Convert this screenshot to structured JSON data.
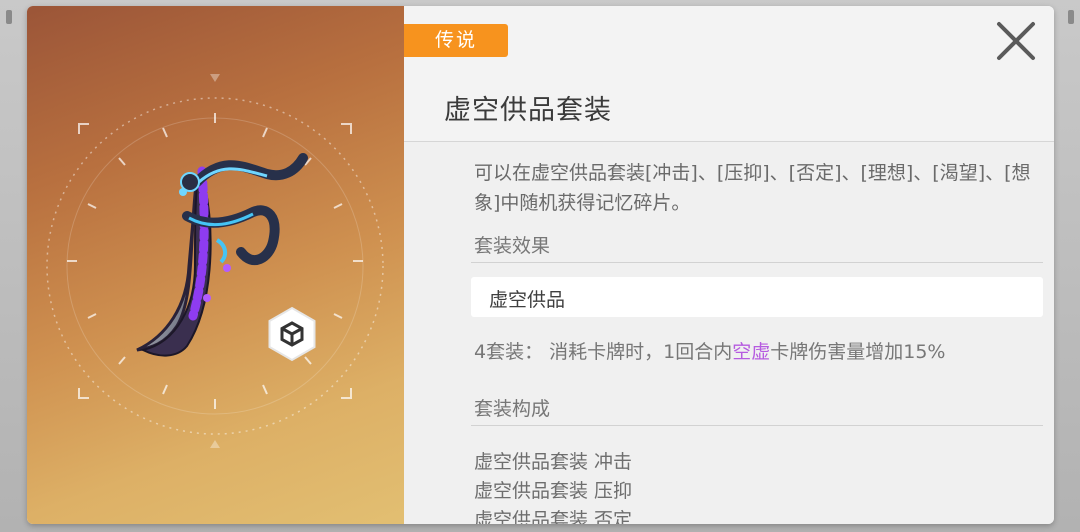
{
  "rarity": "传说",
  "item_name": "虚空供品套装",
  "description": "可以在虚空供品套装[冲击]、[压抑]、[否定]、[理想]、[渴望]、[想象]中随机获得记忆碎片。",
  "set_effect_label": "套装效果",
  "set_name": "虚空供品",
  "set_bonus": {
    "prefix": "4套装：  消耗卡牌时，1回合内",
    "highlight": "空虚",
    "suffix": "卡牌伤害量增加15%"
  },
  "composition_label": "套装构成",
  "components": [
    "虚空供品套装 冲击",
    "虚空供品套装 压抑",
    "虚空供品套装 否定"
  ],
  "icons": {
    "close": "close-icon",
    "item": "void-dagger-icon",
    "type": "cube-type-icon"
  },
  "colors": {
    "rarity": "#f7931e",
    "highlight": "#b65be0"
  }
}
